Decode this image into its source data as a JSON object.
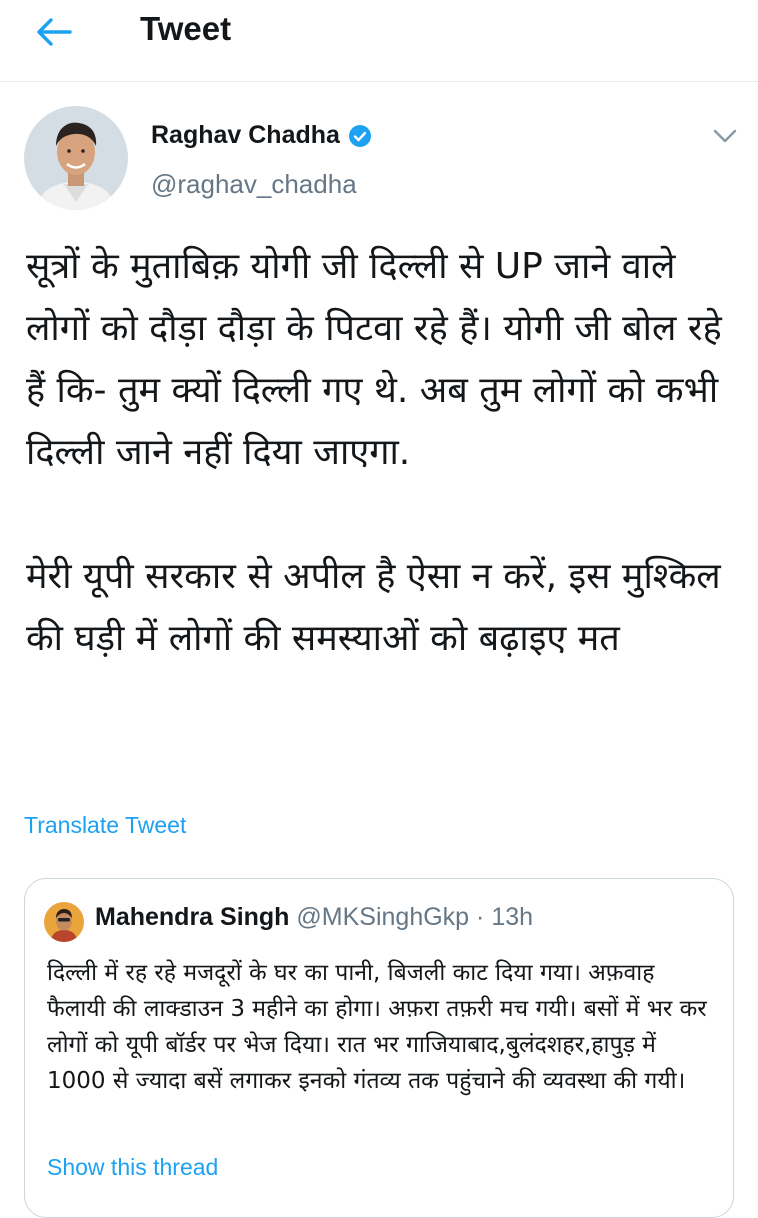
{
  "header": {
    "title": "Tweet",
    "back_icon": "arrow-left-icon"
  },
  "tweet": {
    "author_name": "Raghav Chadha",
    "author_handle": "@raghav_chadha",
    "verified": true,
    "paragraphs": [
      "सूत्रों के मुताबिक़ योगी जी दिल्ली से UP जाने वाले लोगों को दौड़ा दौड़ा के पिटवा रहे हैं। योगी जी बोल रहे हैं कि- तुम क्यों दिल्ली गए थे. अब तुम लोगों को कभी दिल्ली जाने नहीं दिया जाएगा.",
      "मेरी यूपी सरकार से अपील है ऐसा न करें, इस मुश्किल की घड़ी में लोगों की समस्याओं को बढ़ाइए मत"
    ],
    "translate_label": "Translate Tweet"
  },
  "quote": {
    "author_name": "Mahendra Singh",
    "author_handle": "@MKSinghGkp",
    "separator": "·",
    "time": "13h",
    "text": "दिल्ली में रह रहे मजदूरों के घर का पानी, बिजली काट दिया गया। अफ़वाह फैलायी की लाक्डाउन 3 महीने का होगा। अफ़रा तफ़री मच गयी। बसों में भर कर लोगों को यूपी बॉर्डर पर भेज दिया। रात भर गाजियाबाद,बुलंदशहर,हापुड़ में 1000 से ज्यादा बसें लगाकर इनको गंतव्य तक पहुंचाने की व्यवस्था की गयी।",
    "show_thread_label": "Show this thread"
  },
  "colors": {
    "accent": "#1da1f2",
    "text": "#14171a",
    "secondary": "#657786",
    "border": "#e6ecf0"
  }
}
